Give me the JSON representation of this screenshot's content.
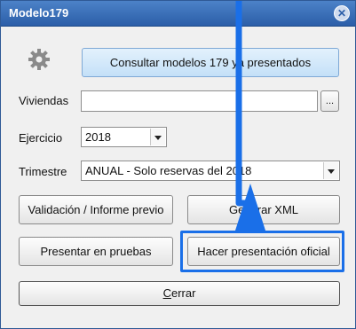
{
  "window": {
    "title": "Modelo179"
  },
  "buttons": {
    "consultar": "Consultar modelos 179 ya presentados",
    "browse": "...",
    "validacion": "Validación / Informe previo",
    "generar_xml": "Generar XML",
    "presentar_pruebas": "Presentar en pruebas",
    "hacer_presentacion": "Hacer presentación oficial",
    "cerrar_prefix": "",
    "cerrar_access_key": "C",
    "cerrar_rest": "errar"
  },
  "fields": {
    "viviendas_label": "Viviendas",
    "viviendas_value": "",
    "ejercicio_label": "Ejercicio",
    "ejercicio_value": "2018",
    "trimestre_label": "Trimestre",
    "trimestre_value": "ANUAL - Solo reservas del 2018"
  },
  "icons": {
    "settings": "gear-icon",
    "close": "close-icon"
  },
  "colors": {
    "title_bar": "#2b5ea8",
    "annotation": "#1a6fe8"
  }
}
